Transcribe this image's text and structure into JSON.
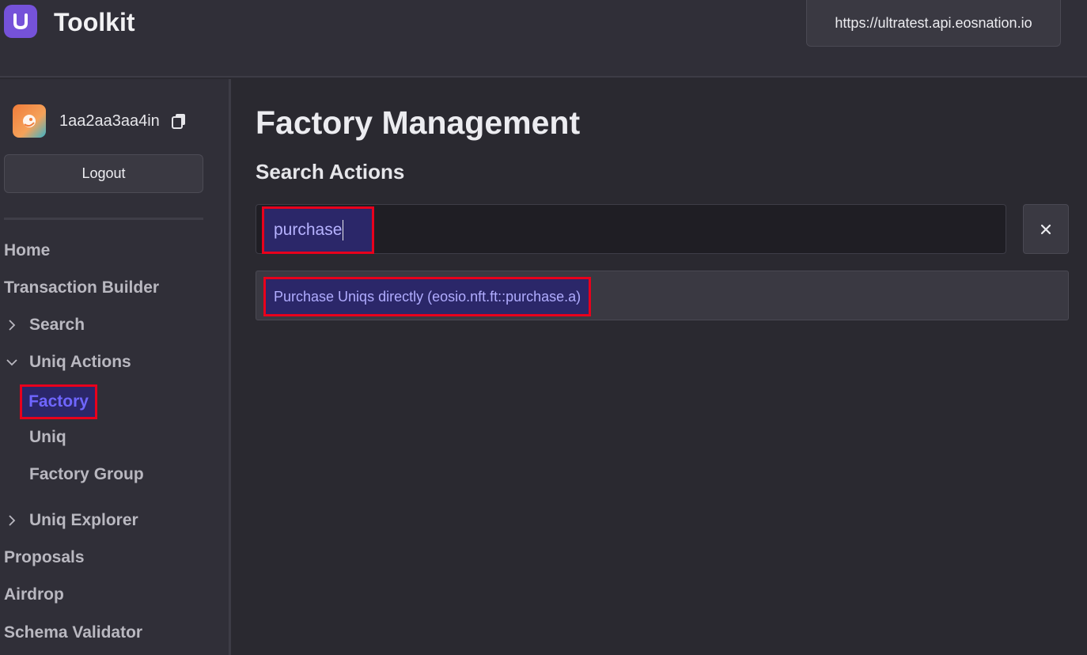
{
  "header": {
    "app_title": "Toolkit",
    "logo_letter": "U",
    "endpoint": "https://ultratest.api.eosnation.io"
  },
  "sidebar": {
    "account_name": "1aa2aa3aa4in",
    "logout_label": "Logout",
    "nav": {
      "home": "Home",
      "transaction_builder": "Transaction Builder",
      "search": "Search",
      "uniq_actions": "Uniq Actions",
      "factory": "Factory",
      "uniq": "Uniq",
      "factory_group": "Factory Group",
      "uniq_explorer": "Uniq Explorer",
      "proposals": "Proposals",
      "airdrop": "Airdrop",
      "schema_validator": "Schema Validator"
    }
  },
  "main": {
    "title": "Factory Management",
    "section_title": "Search Actions",
    "search_value": "purchase",
    "clear_symbol": "×",
    "results": [
      "Purchase Uniqs directly (eosio.nft.ft::purchase.a)"
    ]
  },
  "colors": {
    "background": "#2a2930",
    "panel": "#302f38",
    "accent_purple": "#7552d9",
    "highlight_border": "#e8001c",
    "active_text": "#6f66ff"
  }
}
